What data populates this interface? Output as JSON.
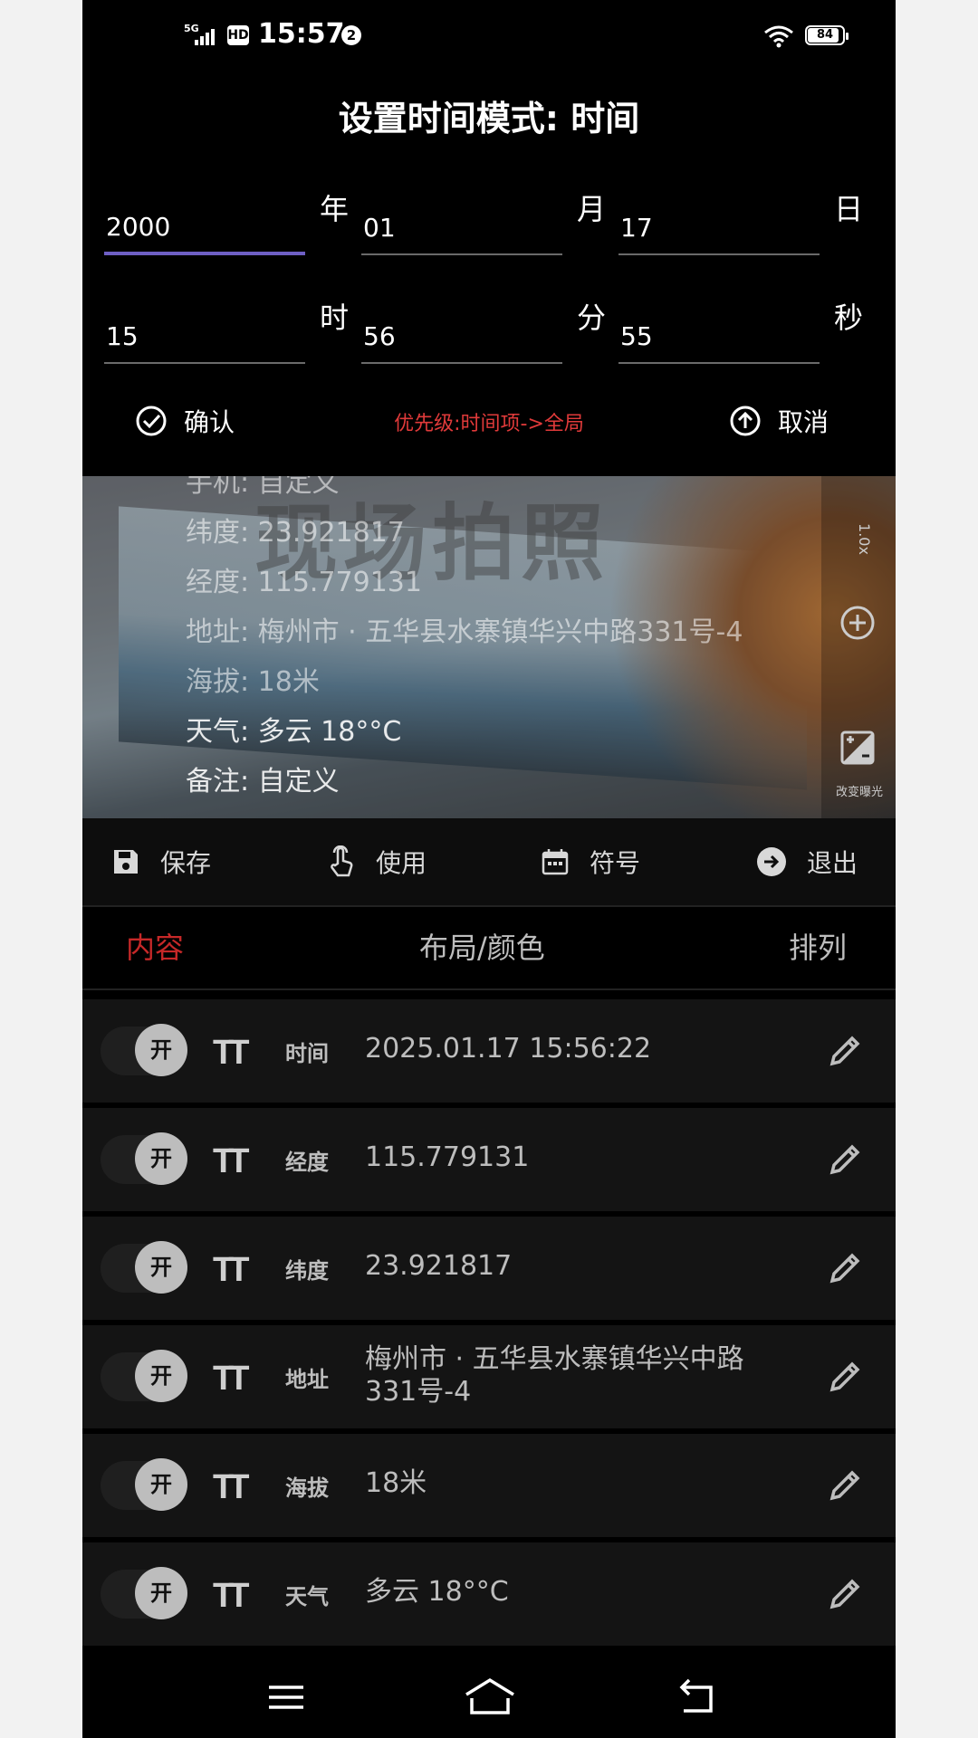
{
  "status_bar": {
    "network": "5G",
    "hd": "HD",
    "time": "15:57",
    "notification_count": "2",
    "battery": "84"
  },
  "dialog": {
    "title": "设置时间模式: 时间",
    "fields": {
      "year": {
        "value": "2000",
        "unit": "年"
      },
      "month": {
        "value": "01",
        "unit": "月"
      },
      "day": {
        "value": "17",
        "unit": "日"
      },
      "hour": {
        "value": "15",
        "unit": "时"
      },
      "minute": {
        "value": "56",
        "unit": "分"
      },
      "second": {
        "value": "55",
        "unit": "秒"
      }
    },
    "confirm_label": "确认",
    "priority_text": "优先级:时间项->全局",
    "cancel_label": "取消"
  },
  "preview": {
    "watermark": "现场拍照",
    "lines": [
      "手机: 自定义",
      "纬度: 23.921817",
      "经度: 115.779131",
      "地址: 梅州市 · 五华县水寨镇华兴中路331号-4",
      "海拔: 18米",
      "天气: 多云 18°°C",
      "备注: 自定义"
    ],
    "side_top": "1.0x",
    "exposure_label": "改变曝光"
  },
  "toolbar": {
    "save": "保存",
    "use": "使用",
    "symbol": "符号",
    "exit": "退出"
  },
  "tabs": {
    "content": "内容",
    "layout_color": "布局/颜色",
    "sort": "排列"
  },
  "rows": [
    {
      "toggle": "开",
      "tt": "TT",
      "label": "时间",
      "value": "2025.01.17  15:56:22"
    },
    {
      "toggle": "开",
      "tt": "TT",
      "label": "经度",
      "value": "115.779131"
    },
    {
      "toggle": "开",
      "tt": "TT",
      "label": "纬度",
      "value": "23.921817"
    },
    {
      "toggle": "开",
      "tt": "TT",
      "label": "地址",
      "value": "梅州市 · 五华县水寨镇华兴中路331号-4"
    },
    {
      "toggle": "开",
      "tt": "TT",
      "label": "海拔",
      "value": "18米"
    },
    {
      "toggle": "开",
      "tt": "TT",
      "label": "天气",
      "value": "多云 18°°C"
    }
  ],
  "colors": {
    "accent_underline": "#6e5fc4",
    "priority_red": "#e03a3a",
    "active_tab": "#c62828"
  }
}
